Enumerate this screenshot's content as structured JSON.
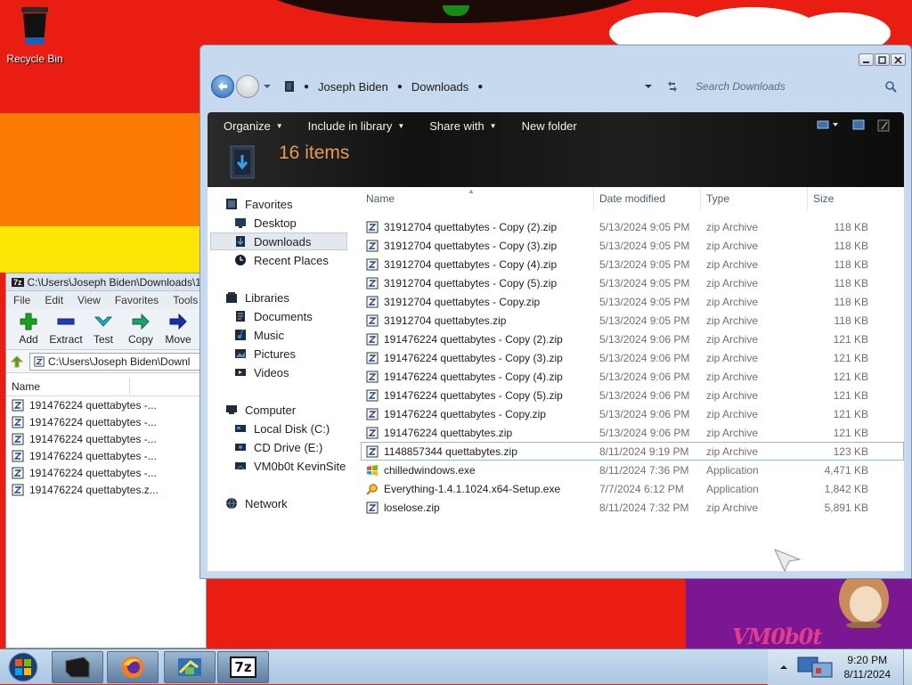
{
  "desktop": {
    "recycle_bin_label": "Recycle Bin",
    "wallpaper_text": "VM0b0t"
  },
  "sevenzip": {
    "title": "C:\\Users\\Joseph Biden\\Downloads\\1",
    "logo": "7z",
    "menu": [
      "File",
      "Edit",
      "View",
      "Favorites",
      "Tools"
    ],
    "tools": [
      "Add",
      "Extract",
      "Test",
      "Copy",
      "Move"
    ],
    "path": "C:\\Users\\Joseph Biden\\Downl",
    "column_name": "Name",
    "rows": [
      "191476224 quettabytes -...",
      "191476224 quettabytes -...",
      "191476224 quettabytes -...",
      "191476224 quettabytes -...",
      "191476224 quettabytes -...",
      "191476224 quettabytes.z..."
    ]
  },
  "explorer": {
    "breadcrumb": [
      "Joseph Biden",
      "Downloads"
    ],
    "search_placeholder": "Search Downloads",
    "commands": [
      "Organize",
      "Include in library",
      "Share with",
      "New folder"
    ],
    "items_count": "16 items",
    "nav": {
      "favorites": "Favorites",
      "desktop": "Desktop",
      "downloads": "Downloads",
      "recent_places": "Recent Places",
      "libraries": "Libraries",
      "documents": "Documents",
      "music": "Music",
      "pictures": "Pictures",
      "videos": "Videos",
      "computer": "Computer",
      "local_disk": "Local Disk (C:)",
      "cd_drive": "CD Drive (E:)",
      "kevinsite": "VM0b0t KevinSite",
      "network": "Network"
    },
    "columns": {
      "name": "Name",
      "date": "Date modified",
      "type": "Type",
      "size": "Size"
    },
    "files": [
      {
        "name": "31912704 quettabytes - Copy (2).zip",
        "date": "5/13/2024 9:05 PM",
        "type": "zip Archive",
        "size": "118 KB",
        "icon": "zip-icon"
      },
      {
        "name": "31912704 quettabytes - Copy (3).zip",
        "date": "5/13/2024 9:05 PM",
        "type": "zip Archive",
        "size": "118 KB",
        "icon": "zip-icon"
      },
      {
        "name": "31912704 quettabytes - Copy (4).zip",
        "date": "5/13/2024 9:05 PM",
        "type": "zip Archive",
        "size": "118 KB",
        "icon": "zip-icon"
      },
      {
        "name": "31912704 quettabytes - Copy (5).zip",
        "date": "5/13/2024 9:05 PM",
        "type": "zip Archive",
        "size": "118 KB",
        "icon": "zip-icon"
      },
      {
        "name": "31912704 quettabytes - Copy.zip",
        "date": "5/13/2024 9:05 PM",
        "type": "zip Archive",
        "size": "118 KB",
        "icon": "zip-icon"
      },
      {
        "name": "31912704 quettabytes.zip",
        "date": "5/13/2024 9:05 PM",
        "type": "zip Archive",
        "size": "118 KB",
        "icon": "zip-icon"
      },
      {
        "name": "191476224 quettabytes - Copy (2).zip",
        "date": "5/13/2024 9:06 PM",
        "type": "zip Archive",
        "size": "121 KB",
        "icon": "zip-icon"
      },
      {
        "name": "191476224 quettabytes - Copy (3).zip",
        "date": "5/13/2024 9:06 PM",
        "type": "zip Archive",
        "size": "121 KB",
        "icon": "zip-icon"
      },
      {
        "name": "191476224 quettabytes - Copy (4).zip",
        "date": "5/13/2024 9:06 PM",
        "type": "zip Archive",
        "size": "121 KB",
        "icon": "zip-icon"
      },
      {
        "name": "191476224 quettabytes - Copy (5).zip",
        "date": "5/13/2024 9:06 PM",
        "type": "zip Archive",
        "size": "121 KB",
        "icon": "zip-icon"
      },
      {
        "name": "191476224 quettabytes - Copy.zip",
        "date": "5/13/2024 9:06 PM",
        "type": "zip Archive",
        "size": "121 KB",
        "icon": "zip-icon"
      },
      {
        "name": "191476224 quettabytes.zip",
        "date": "5/13/2024 9:06 PM",
        "type": "zip Archive",
        "size": "121 KB",
        "icon": "zip-icon"
      },
      {
        "name": "1148857344 quettabytes.zip",
        "date": "8/11/2024 9:19 PM",
        "type": "zip Archive",
        "size": "123 KB",
        "icon": "zip-icon",
        "focused": true
      },
      {
        "name": "chilledwindows.exe",
        "date": "8/11/2024 7:36 PM",
        "type": "Application",
        "size": "4,471 KB",
        "icon": "windows-flag-icon"
      },
      {
        "name": "Everything-1.4.1.1024.x64-Setup.exe",
        "date": "7/7/2024 6:12 PM",
        "type": "Application",
        "size": "1,842 KB",
        "icon": "magnifier-icon"
      },
      {
        "name": "loselose.zip",
        "date": "8/11/2024 7:32 PM",
        "type": "zip Archive",
        "size": "5,891 KB",
        "icon": "zip-icon"
      }
    ]
  },
  "taskbar": {
    "time": "9:20 PM",
    "date": "8/11/2024",
    "sevenzip_label": "7z"
  },
  "colors": {
    "accent_orange": "#e39c51",
    "desktop_red": "#ea1d12",
    "desktop_orange": "#fd7a05",
    "desktop_yellow": "#fde606"
  }
}
